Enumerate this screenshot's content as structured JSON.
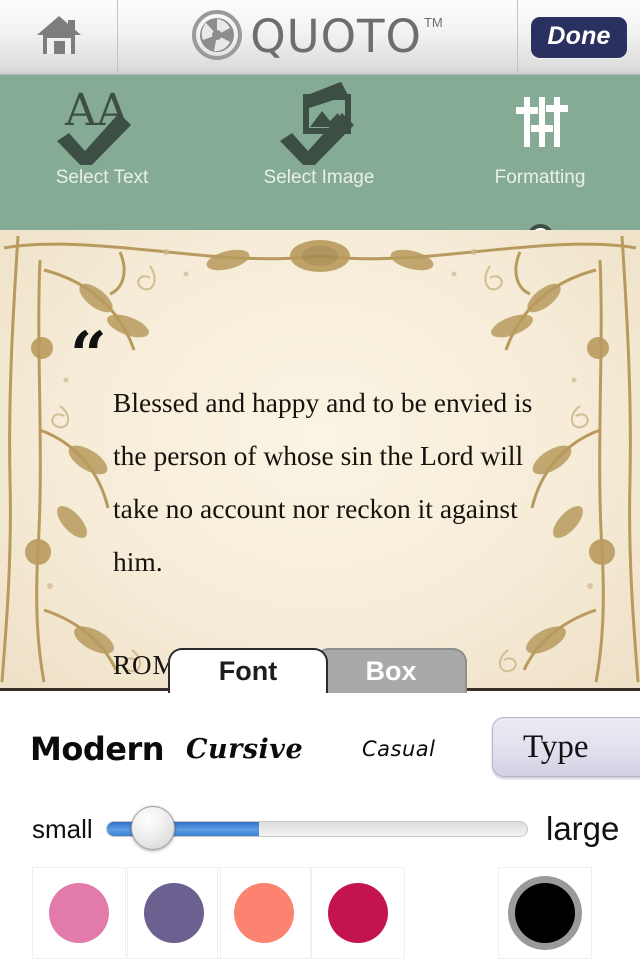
{
  "topbar": {
    "home_icon": "home-icon",
    "logo_icon": "aperture-logo-icon",
    "brand": "QUOTO",
    "trademark": "TM",
    "done_label": "Done"
  },
  "steps": {
    "track_color": "#3d4f44",
    "bar_color": "#86ab95",
    "items": [
      {
        "label": "Select Text",
        "icon": "text-aa-check-icon",
        "state": "completed"
      },
      {
        "label": "Select Image",
        "icon": "image-check-icon",
        "state": "completed"
      },
      {
        "label": "Formatting",
        "icon": "sliders-icon",
        "state": "current"
      }
    ]
  },
  "canvas": {
    "quote_mark": "“",
    "quote_text": "Blessed and happy and to be envied is the person of whose sin the Lord will take no account nor reckon it against him.",
    "attribution": "ROM",
    "paper_color": "#f6ecd8",
    "ornament_color": "#b89a5e"
  },
  "tabs": [
    {
      "label": "Font",
      "active": true
    },
    {
      "label": "Box",
      "active": false
    }
  ],
  "panel": {
    "fonts": [
      {
        "label": "Modern",
        "style": "modern"
      },
      {
        "label": "Cursive",
        "style": "cursive"
      },
      {
        "label": "Casual",
        "style": "casual"
      }
    ],
    "type_button": "Type",
    "slider": {
      "min_label": "small",
      "max_label": "large",
      "value_percent": 36,
      "fill_color": "#3d82d4"
    },
    "swatches": [
      {
        "name": "pink",
        "color": "#e27bab",
        "selected": false
      },
      {
        "name": "purple",
        "color": "#6b6090",
        "selected": false
      },
      {
        "name": "coral",
        "color": "#fc8370",
        "selected": false
      },
      {
        "name": "crimson",
        "color": "#c41450",
        "selected": false
      },
      {
        "name": "black",
        "color": "#000000",
        "selected": true
      }
    ]
  }
}
